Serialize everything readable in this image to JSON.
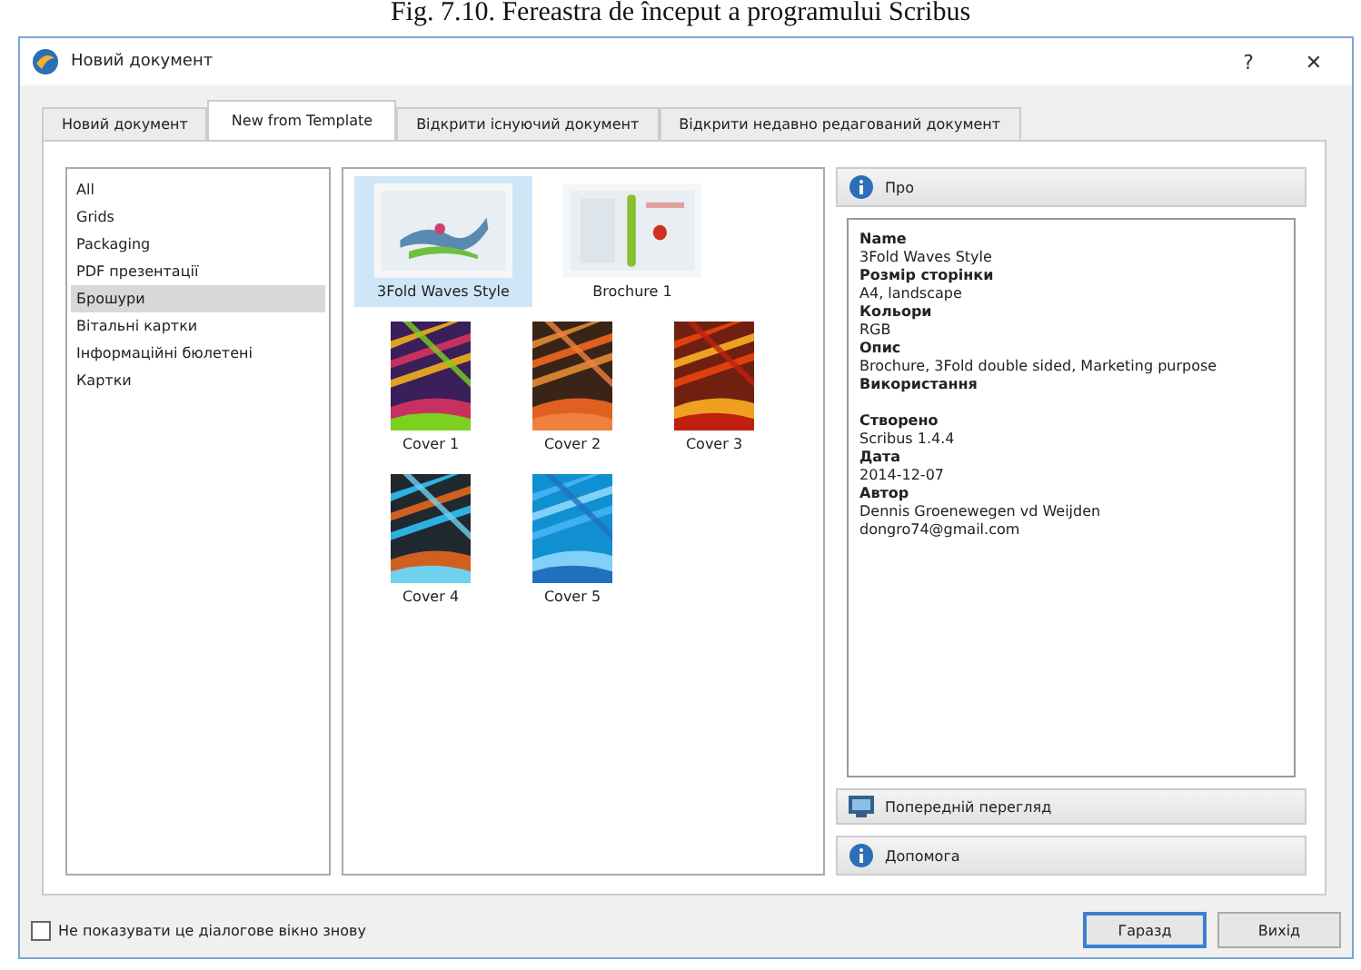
{
  "caption": "Fig. 7.10. Fereastra de început a programului Scribus",
  "window": {
    "title": "Новий документ",
    "help": "?",
    "close": "✕"
  },
  "tabs": [
    {
      "label": "Новий документ",
      "selected": false
    },
    {
      "label": "New from Template",
      "selected": true
    },
    {
      "label": "Відкрити існуючий документ",
      "selected": false
    },
    {
      "label": "Відкрити недавно редагований документ",
      "selected": false
    }
  ],
  "categories": [
    {
      "label": "All",
      "selected": false
    },
    {
      "label": "Grids",
      "selected": false
    },
    {
      "label": "Packaging",
      "selected": false
    },
    {
      "label": "PDF презентації",
      "selected": false
    },
    {
      "label": "Брошури",
      "selected": true
    },
    {
      "label": "Вітальні картки",
      "selected": false
    },
    {
      "label": "Інформаційні бюлетені",
      "selected": false
    },
    {
      "label": "Картки",
      "selected": false
    }
  ],
  "templates": [
    {
      "label": "3Fold Waves Style",
      "selected": true,
      "kind": "landscape"
    },
    {
      "label": "Brochure 1",
      "selected": false,
      "kind": "landscape"
    },
    {
      "label": "Cover 1",
      "selected": false,
      "kind": "portrait"
    },
    {
      "label": "Cover 2",
      "selected": false,
      "kind": "portrait"
    },
    {
      "label": "Cover 3",
      "selected": false,
      "kind": "portrait"
    },
    {
      "label": "Cover 4",
      "selected": false,
      "kind": "portrait"
    },
    {
      "label": "Cover 5",
      "selected": false,
      "kind": "portrait"
    }
  ],
  "about_button": "Про",
  "details": [
    {
      "kind": "label",
      "text": "Name"
    },
    {
      "kind": "value",
      "text": "3Fold Waves Style"
    },
    {
      "kind": "label",
      "text": "Розмір сторінки"
    },
    {
      "kind": "value",
      "text": "A4, landscape"
    },
    {
      "kind": "label",
      "text": "Кольори"
    },
    {
      "kind": "value",
      "text": "RGB"
    },
    {
      "kind": "label",
      "text": "Опис"
    },
    {
      "kind": "value",
      "text": "Brochure, 3Fold double sided, Marketing purpose"
    },
    {
      "kind": "label",
      "text": "Використання"
    },
    {
      "kind": "blank"
    },
    {
      "kind": "label",
      "text": "Створено"
    },
    {
      "kind": "value",
      "text": "Scribus 1.4.4"
    },
    {
      "kind": "label",
      "text": "Дата"
    },
    {
      "kind": "value",
      "text": "2014-12-07"
    },
    {
      "kind": "label",
      "text": "Автор"
    },
    {
      "kind": "value",
      "text": "Dennis Groenewegen vd Weijden"
    },
    {
      "kind": "value",
      "text": "dongro74@gmail.com"
    }
  ],
  "preview_button": "Попередній перегляд",
  "help_button": "Допомога",
  "dont_show": {
    "label": "Не показувати це діалогове вікно знову",
    "checked": false
  },
  "ok_button": "Гаразд",
  "exit_button": "Вихід"
}
